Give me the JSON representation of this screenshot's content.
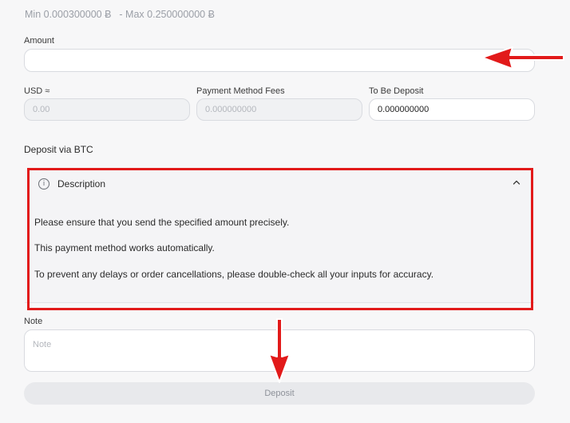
{
  "limits": {
    "min": "Min 0.000300000 Ƀ",
    "max": "- Max 0.250000000 Ƀ"
  },
  "amount": {
    "label": "Amount",
    "value": ""
  },
  "usd": {
    "label": "USD ≈",
    "value": "0.00"
  },
  "fees": {
    "label": "Payment Method Fees",
    "value": "0.000000000"
  },
  "to_be_deposit": {
    "label": "To Be Deposit",
    "value": "0.000000000"
  },
  "deposit_via": "Deposit via BTC",
  "description": {
    "title": "Description",
    "lines": [
      "Please ensure that you send the specified amount precisely.",
      "This payment method works automatically.",
      "To prevent any delays or order cancellations, please double-check all your inputs for accuracy."
    ]
  },
  "note": {
    "label": "Note",
    "placeholder": "Note"
  },
  "deposit_button": "Deposit",
  "colors": {
    "annotation_red": "#e21a1a",
    "background": "#f7f7f8"
  }
}
